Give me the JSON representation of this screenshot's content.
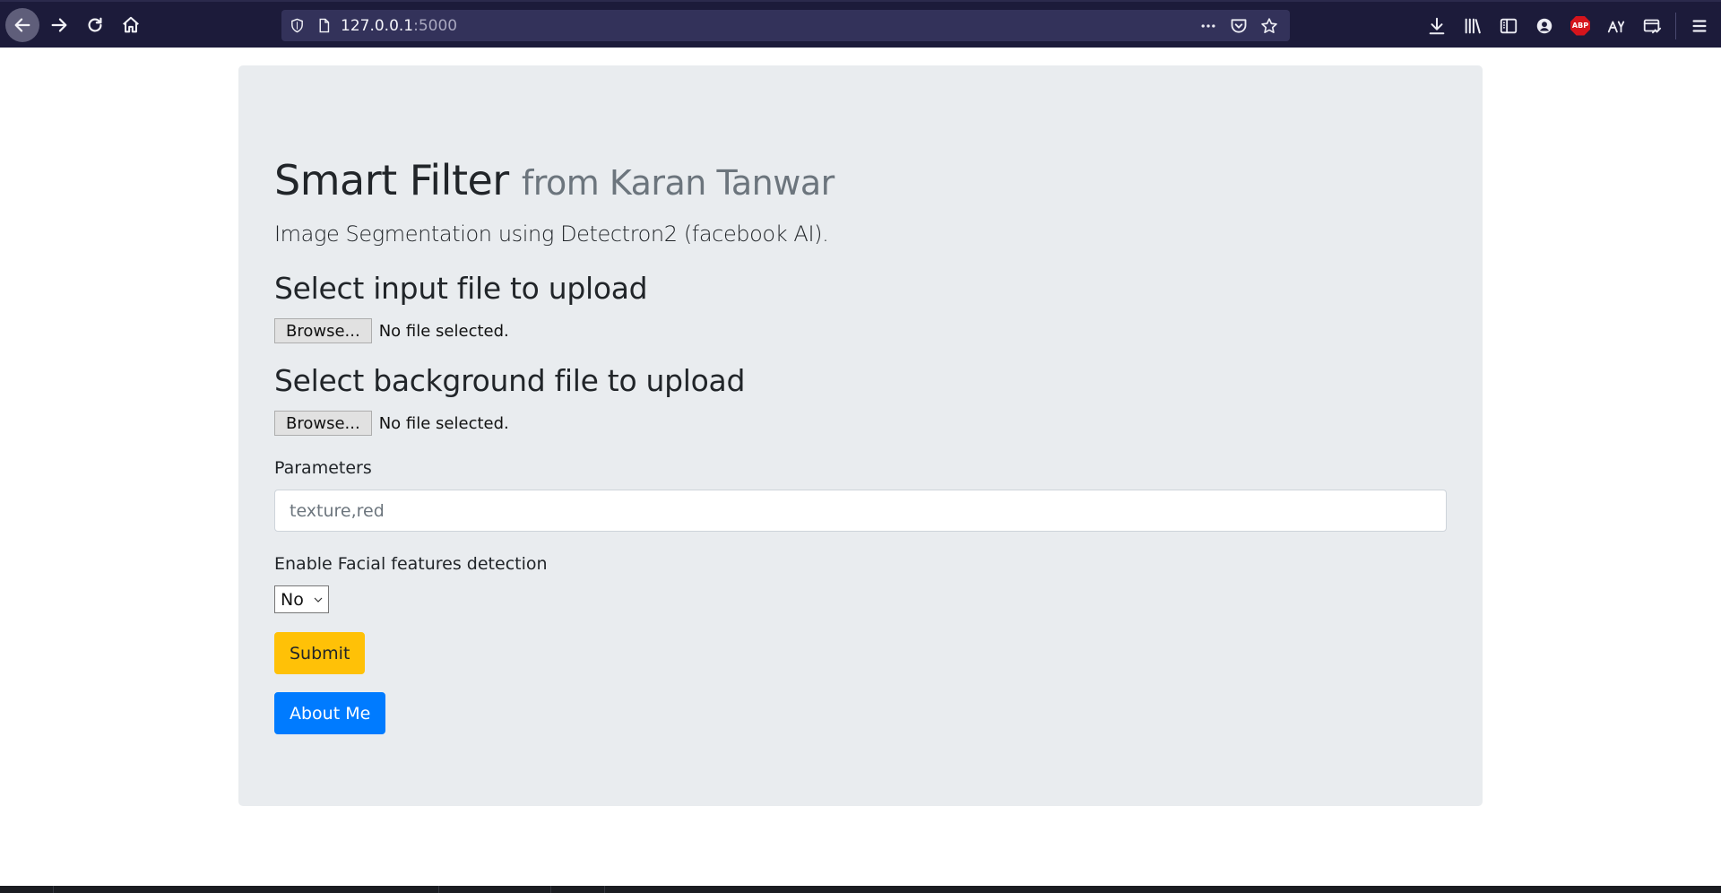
{
  "browser": {
    "url_host": "127.0.0.1",
    "url_port": ":5000"
  },
  "page": {
    "title": "Smart Filter",
    "title_muted": "from Karan Tanwar",
    "lead": "Image Segmentation using Detectron2 (facebook AI).",
    "input_file": {
      "heading": "Select input file to upload",
      "browse_label": "Browse...",
      "status": "No file selected."
    },
    "background_file": {
      "heading": "Select background file to upload",
      "browse_label": "Browse...",
      "status": "No file selected."
    },
    "parameters": {
      "label": "Parameters",
      "placeholder": "texture,red",
      "value": ""
    },
    "facial": {
      "label": "Enable Facial features detection",
      "selected": "No"
    },
    "submit_label": "Submit",
    "about_label": "About Me"
  },
  "colors": {
    "chrome_bg": "#1c1b3a",
    "urlbar_bg": "#33325a",
    "jumbotron_bg": "#e9ecef",
    "warning": "#ffc107",
    "primary": "#007bff",
    "abp_red": "#d5141c"
  },
  "icons": {
    "back": "back-arrow-icon",
    "forward": "forward-arrow-icon",
    "reload": "reload-icon",
    "home": "home-icon",
    "shield": "tracking-shield-icon",
    "page": "page-icon",
    "more": "more-actions-icon",
    "pocket": "pocket-icon",
    "bookmark": "bookmark-star-icon",
    "download": "download-icon",
    "library": "library-icon",
    "sidebar": "sidebar-icon",
    "account": "account-icon",
    "adblock": "adblock-plus-icon",
    "translate": "translate-icon",
    "screenshot": "screenshot-icon",
    "menu": "hamburger-menu-icon"
  },
  "extensions": {
    "adblock_text": "ABP"
  }
}
